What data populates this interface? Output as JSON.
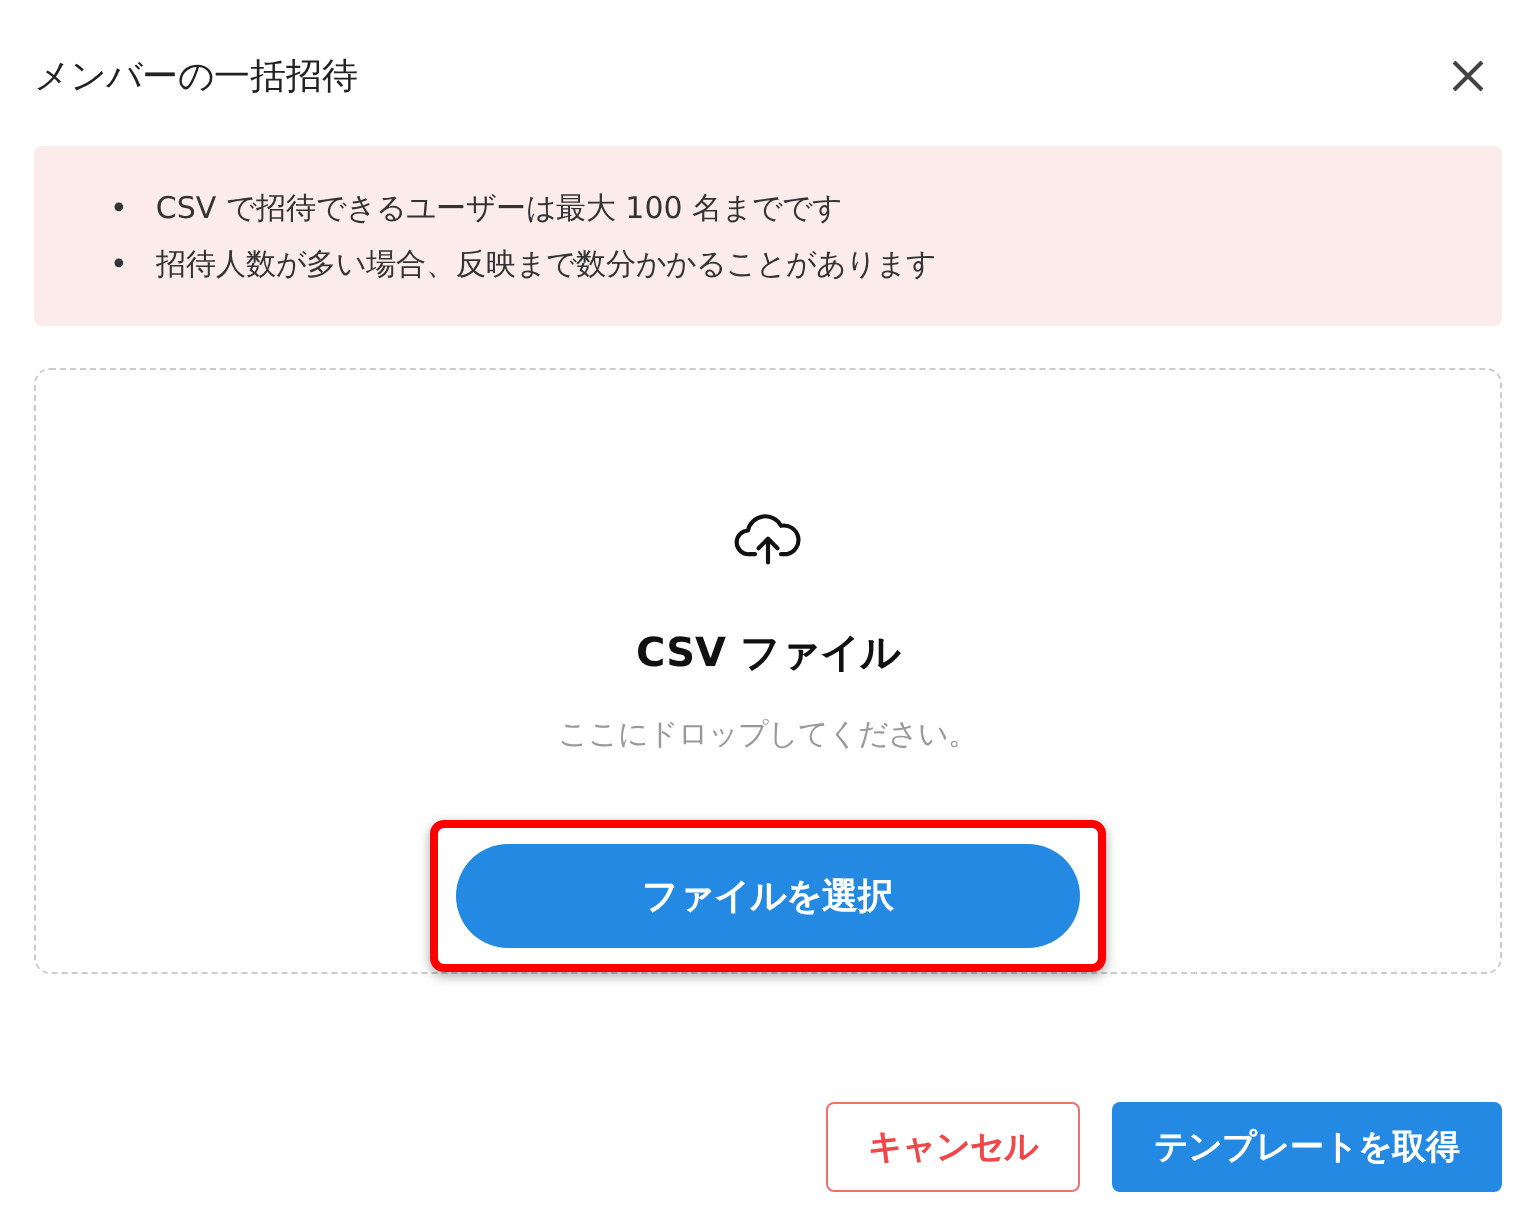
{
  "dialog": {
    "title": "メンバーの一括招待"
  },
  "notice": {
    "items": [
      {
        "bullet": "•",
        "text": "CSV で招待できるユーザーは最大 100 名までです"
      },
      {
        "bullet": "•",
        "text": "招待人数が多い場合、反映まで数分かかることがあります"
      }
    ]
  },
  "dropzone": {
    "title": "CSV ファイル",
    "hint": "ここにドロップしてください。",
    "button": "ファイルを選択",
    "highlighted": true
  },
  "buttons": [
    {
      "label": "キャンセル",
      "kind": "secondary"
    },
    {
      "label": "テンプレートを取得",
      "kind": "primary"
    }
  ]
}
